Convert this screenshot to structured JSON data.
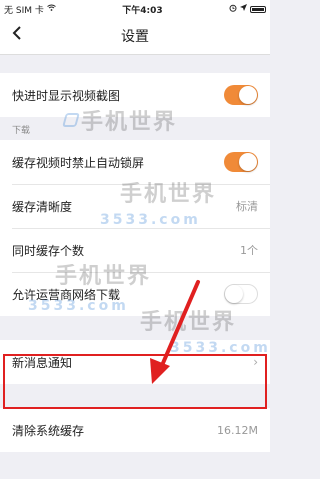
{
  "status_bar": {
    "carrier": "无 SIM 卡",
    "time": "下午4:03",
    "icons": [
      "wifi-icon",
      "alarm-icon",
      "location-icon",
      "battery-icon"
    ]
  },
  "nav": {
    "back_icon": "chevron-left-icon",
    "title": "设置"
  },
  "rows": {
    "show_thumbnails": {
      "label": "快进时显示视频截图",
      "toggle": "on"
    },
    "download_section": "下载",
    "disable_lock": {
      "label": "缓存视频时禁止自动锁屏",
      "toggle": "on"
    },
    "clarity": {
      "label": "缓存清晰度",
      "value": "标清"
    },
    "concurrent": {
      "label": "同时缓存个数",
      "value": "1个"
    },
    "cellular": {
      "label": "允许运营商网络下载",
      "toggle": "off"
    },
    "notifications": {
      "label": "新消息通知",
      "chevron": "›"
    },
    "clear_cache": {
      "label": "清除系统缓存",
      "value": "16.12M"
    }
  },
  "watermark": {
    "title": "手机世界",
    "sub": "3533.com"
  },
  "colors": {
    "accent": "#f08a38",
    "highlight": "#e02020",
    "background": "#efeff4"
  }
}
